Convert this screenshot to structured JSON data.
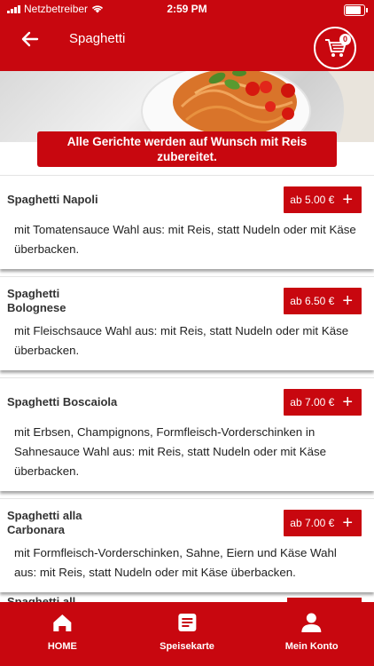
{
  "status_bar": {
    "carrier": "Netzbetreiber",
    "time": "2:59 PM"
  },
  "header": {
    "title": "Spaghetti",
    "cart_count": "0"
  },
  "notice": "Alle Gerichte werden auf Wunsch mit Reis zubereitet.",
  "items": [
    {
      "name": "Spaghetti Napoli",
      "price": "ab 5.00 €",
      "description": "mit Tomatensauce Wahl aus: mit Reis, statt Nudeln oder mit Käse überbacken."
    },
    {
      "name": "Spaghetti Bolognese",
      "price": "ab 6.50 €",
      "description": "mit Fleischsauce Wahl aus: mit Reis, statt Nudeln oder mit Käse überbacken."
    },
    {
      "name": "Spaghetti Boscaiola",
      "price": "ab 7.00 €",
      "description": "mit Erbsen, Champignons, Formfleisch-Vorderschinken in Sahnesauce Wahl aus: mit Reis, statt Nudeln oder mit Käse überbacken."
    },
    {
      "name": "Spaghetti alla Carbonara",
      "price": "ab 7.00 €",
      "description": "mit Formfleisch-Vorderschinken, Sahne, Eiern und Käse Wahl aus: mit Reis, statt Nudeln oder mit Käse überbacken."
    }
  ],
  "partial_item": "Spaghetti all",
  "tabs": [
    {
      "label": "HOME",
      "icon": "home-icon"
    },
    {
      "label": "Speisekarte",
      "icon": "menu-card-icon"
    },
    {
      "label": "Mein Konto",
      "icon": "account-icon"
    }
  ],
  "colors": {
    "brand": "#c8070f",
    "text": "#222222"
  }
}
